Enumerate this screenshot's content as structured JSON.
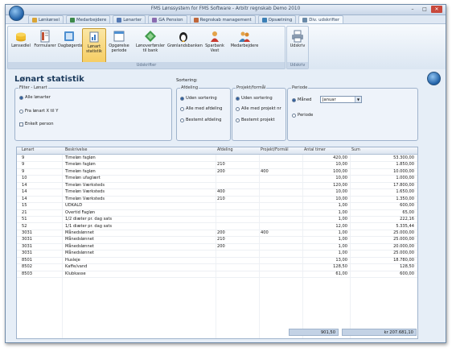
{
  "window": {
    "title": "FMS Lønssystem for FMS Software - Arbitr regnskab Demo 2010"
  },
  "tabs": [
    {
      "label": "Lønkørsel",
      "color": "#d9a436"
    },
    {
      "label": "Medarbejdere",
      "color": "#3d8a4a"
    },
    {
      "label": "Lønarter",
      "color": "#5479b3"
    },
    {
      "label": "GA Pension",
      "color": "#8a6bb0"
    },
    {
      "label": "Regnskab management",
      "color": "#c0673a"
    },
    {
      "label": "Opsætning",
      "color": "#3b7fb5"
    },
    {
      "label": "Div. udskrifter",
      "color": "#6a8aa8"
    }
  ],
  "ribbon": {
    "group_udskrifter": "Udskrifter",
    "group_udskriv": "Udskriv",
    "buttons": [
      {
        "label": "Lønsedlel",
        "icon": "coins-icon"
      },
      {
        "label": "Formularer",
        "icon": "forms-icon"
      },
      {
        "label": "Dagbøgerdag",
        "icon": "journal-icon"
      },
      {
        "label": "Lønart statistik",
        "icon": "statistics-icon"
      },
      {
        "label": "Opgørelse periode",
        "icon": "period-icon"
      },
      {
        "label": "Lønoverførsler til bank",
        "icon": "bank-transfer-icon"
      },
      {
        "label": "Grønlandsbanken",
        "icon": "penguin-icon"
      },
      {
        "label": "Sparbank Vest",
        "icon": "person-icon"
      },
      {
        "label": "Medarbejdere",
        "icon": "employees-icon"
      },
      {
        "label": "Udskriv",
        "icon": "printer-icon"
      }
    ]
  },
  "main": {
    "title": "Lønart statistik",
    "sortering_label": "Sortering:",
    "filter": {
      "legend": "Filter - Lønart",
      "opt_all": "Alle lønarter",
      "opt_from": "Fra lønart X til Y",
      "opt_person": "Enkelt person"
    },
    "afdeling": {
      "legend": "Afdeling",
      "opt1": "Uden sortering",
      "opt2": "Alle med afdeling",
      "opt3": "Bestemt afdeling"
    },
    "projekt": {
      "legend": "Projekt/formål",
      "opt1": "Uden sortering",
      "opt2": "Alle med projekt nr",
      "opt3": "Bestemt projekt"
    },
    "periode": {
      "legend": "Periode",
      "opt_month": "Måned",
      "month_value": "Januar",
      "opt_period": "Periode"
    }
  },
  "grid": {
    "columns": [
      "Lønart",
      "Beskrivelse",
      "Afdeling",
      "Projekt/Formål",
      "Antal timer",
      "Sum"
    ],
    "rows": [
      [
        "9",
        "Timeløn fagløn",
        "",
        "",
        "420,00",
        "53.300,00"
      ],
      [
        "9",
        "Timeløn fagløn",
        "210",
        "",
        "10,00",
        "1.850,00"
      ],
      [
        "9",
        "Timeløn fagløn",
        "200",
        "400",
        "100,00",
        "10.000,00"
      ],
      [
        "10",
        "Timeløn ufaglært",
        "",
        "",
        "10,00",
        "1.000,00"
      ],
      [
        "14",
        "Timeløn Værksteds",
        "",
        "",
        "120,00",
        "17.800,00"
      ],
      [
        "14",
        "Timeløn Værksteds",
        "400",
        "",
        "10,00",
        "1.650,00"
      ],
      [
        "14",
        "Timeløn Værksteds",
        "210",
        "",
        "10,00",
        "1.350,00"
      ],
      [
        "15",
        "UDKALD",
        "",
        "",
        "1,00",
        "600,00"
      ],
      [
        "21",
        "Overtid Fagløn",
        "",
        "",
        "1,00",
        "65,00"
      ],
      [
        "51",
        "1/2 diæter pr. dag sats",
        "",
        "",
        "1,00",
        "222,16"
      ],
      [
        "52",
        "1/1 diæter pr. dag sats",
        "",
        "",
        "12,00",
        "5.335,44"
      ],
      [
        "3031",
        "Månedslønnet",
        "200",
        "400",
        "1,00",
        "25.000,00"
      ],
      [
        "3031",
        "Månedslønnet",
        "210",
        "",
        "1,00",
        "25.000,00"
      ],
      [
        "3031",
        "Månedslønnet",
        "200",
        "",
        "1,00",
        "20.000,00"
      ],
      [
        "3031",
        "Månedslønnet",
        "",
        "",
        "1,00",
        "25.000,00"
      ],
      [
        "8501",
        "Husleje",
        "",
        "",
        "13,00",
        "18.780,00"
      ],
      [
        "8502",
        "Kaffe/vand",
        "",
        "",
        "128,50",
        "128,50"
      ],
      [
        "8503",
        "Klubkasse",
        "",
        "",
        "61,00",
        "600,00"
      ]
    ],
    "total_hours": "901,50",
    "total_sum": "kr 207.681,10"
  }
}
